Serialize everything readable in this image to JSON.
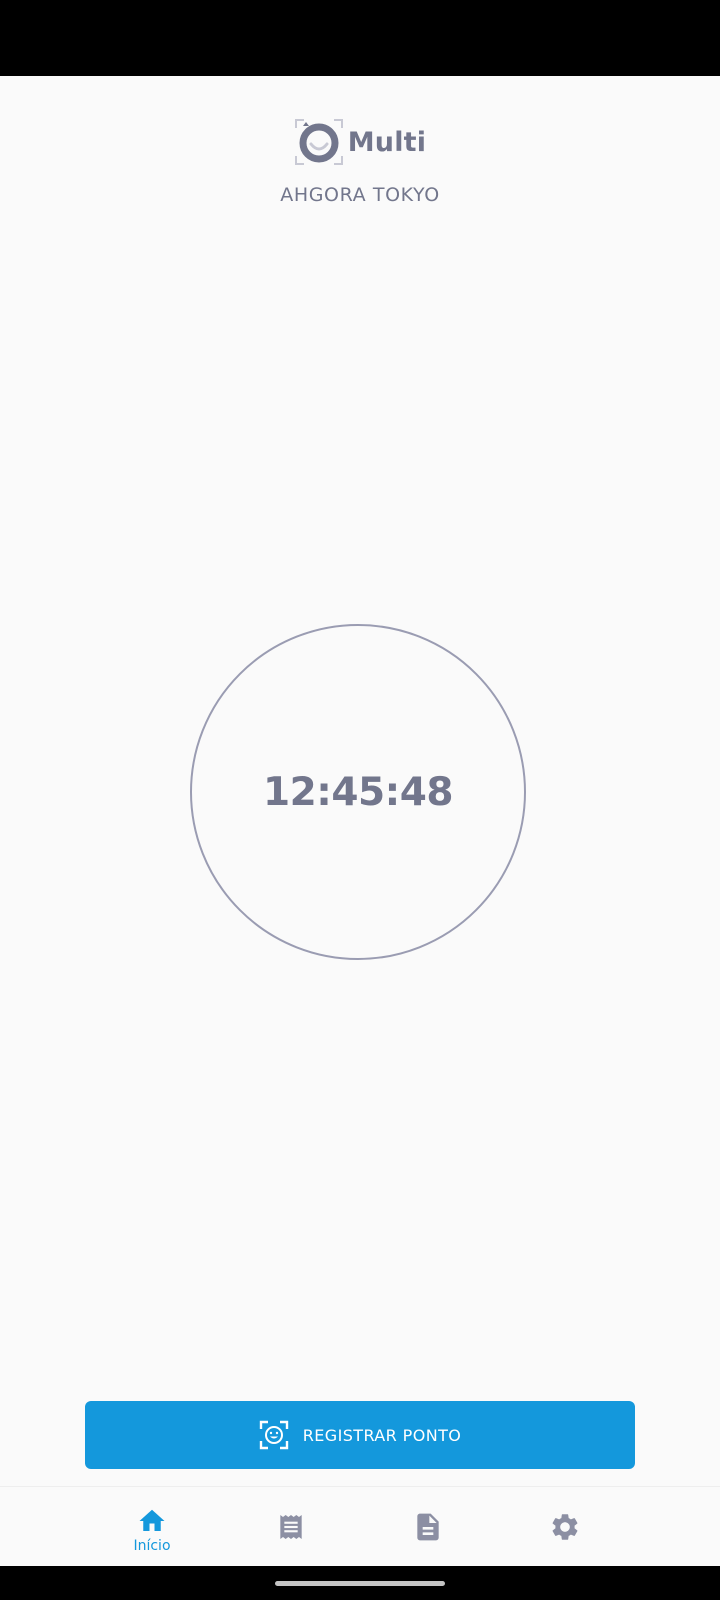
{
  "app": {
    "logo_text": "Multi",
    "company_name": "AHGORA TOKYO"
  },
  "clock": {
    "time": "12:45:48"
  },
  "actions": {
    "register_label": "REGISTRAR PONTO",
    "register_icon": "face-scan-icon"
  },
  "bottom_nav": {
    "items": [
      {
        "label": "Início",
        "icon": "home-icon",
        "active": true
      },
      {
        "label": "",
        "icon": "receipt-icon",
        "active": false
      },
      {
        "label": "",
        "icon": "document-icon",
        "active": false
      },
      {
        "label": "",
        "icon": "gear-icon",
        "active": false
      }
    ]
  },
  "colors": {
    "accent": "#1498dc",
    "text_gray": "#72768c",
    "icon_gray": "#8c8fa3",
    "ring": "#9a9cb2",
    "background": "#fafafa"
  }
}
